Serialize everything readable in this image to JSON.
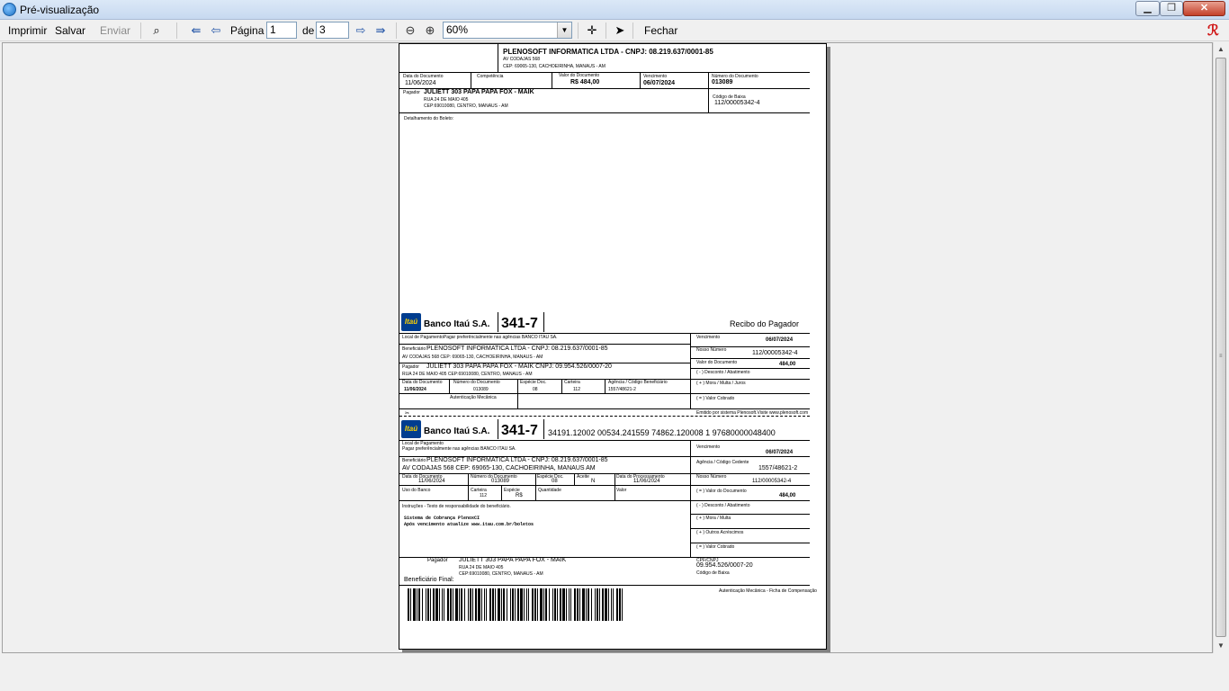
{
  "window": {
    "title": "Pré-visualização"
  },
  "toolbar": {
    "print_label": "Imprimir",
    "save_label": "Salvar",
    "send_label": "Enviar",
    "page_label": "Página",
    "page_value": "1",
    "of_label": "de",
    "total_pages": "3",
    "zoom_value": "60%",
    "close_label": "Fechar"
  },
  "report": {
    "header": {
      "company": "PLENOSOFT INFORMATICA LTDA - CNPJ: 08.219.637/0001-85",
      "address1": "AV CODAJAS 568",
      "address2": "CEP: 69065-130, CACHOEIRINHA, MANAUS - AM"
    },
    "doc_row": {
      "data_doc_label": "Data do Documento",
      "data_doc": "11/06/2024",
      "competencia_label": "Competência",
      "valor_doc_label": "Valor do Documento",
      "valor_doc": "R$ 484,00",
      "vencimento_label": "Vencimento",
      "vencimento": "06/07/2024",
      "numero_doc_label": "Número do Documento",
      "numero_doc": "013089"
    },
    "payer": {
      "label": "Pagador",
      "name": "JULIETT 303 PAPA PAPA FOX - MAIK",
      "addr1": "RUA 24 DE MAIO 405",
      "addr2": "CEP:69010080, CENTRO, MANAUS - AM",
      "codigo_baixa_label": "Código de Baixa",
      "codigo_baixa": "112/00005342-4"
    },
    "detalhamento_label": "Detalhamento do Boleto:"
  },
  "recibo": {
    "bank_logo": "Itaú",
    "bank_name": "Banco Itaú S.A.",
    "bank_code": "341-7",
    "title": "Recibo do Pagador",
    "local_pagamento": "Local de PagamentoPagar preferêncialmente nas agências BANCO ITAU SA.",
    "vencimento_label": "Vencimento",
    "vencimento": "06/07/2024",
    "beneficiario_label": "Beneficiário",
    "beneficiario": "PLENOSOFT INFORMATICA LTDA - CNPJ: 08.219.637/0001-85",
    "beneficiario_addr": "AV CODAJAS 568   CEP: 69065-130, CACHOEIRINHA, MANAUS - AM",
    "nosso_numero_label": "Nosso Número",
    "nosso_numero": "112/00005342-4",
    "pagador_label": "Pagador",
    "pagador": "JULIETT 303 PAPA PAPA FOX - MAIK  CNPJ: 09.954.526/0007-20",
    "pagador_addr": "RUA 24 DE MAIO 405  CEP:69010080, CENTRO, MANAUS - AM",
    "valor_doc_label": "Valor do Documento",
    "valor_doc": "484,00",
    "desconto_label": "( - ) Desconto / Abatimento",
    "data_doc_label": "Data do Documento",
    "data_doc": "11/06/2024",
    "numero_doc_label": "Número do Documento",
    "numero_doc": "013089",
    "especie_doc_label": "Espécie Doc.",
    "especie_doc": "08",
    "carteira_label": "Carteira",
    "carteira": "112",
    "agencia_label": "Agência / Código Beneficiário",
    "agencia": "1557/48621-2",
    "mora_label": "( + ) Mora / Multa / Juros",
    "autenticacao": "Autenticação Mecânica",
    "valor_cobrado_label": "( = ) Valor Cobrado",
    "emitido": "Emitido por sistema Plenosoft.Visite www.plenosoft.com",
    "cut_mark": "✂"
  },
  "ficha": {
    "bank_logo": "Itaú",
    "bank_name": "Banco Itaú S.A.",
    "bank_code": "341-7",
    "linha_digitavel": "34191.12002 00534.241559 74862.120008 1 97680000048400",
    "local_label": "Local de Pagamento",
    "local": "Pagar preferêncialmente nas agências BANCO ITAU SA.",
    "vencimento_label": "Vencimento",
    "vencimento": "06/07/2024",
    "beneficiario_label": "Beneficiário",
    "beneficiario": "PLENOSOFT INFORMATICA LTDA - CNPJ: 08.219.637/0001-85",
    "beneficiario_addr": "AV CODAJAS 568  CEP: 69065-130, CACHOEIRINHA, MANAUS AM",
    "agencia_label": "Agência / Código Cedente",
    "agencia": "1557/48621-2",
    "data_doc_label": "Data do Documento",
    "data_doc": "11/06/2024",
    "numero_doc_label": "Número do Documento",
    "numero_doc": "013089",
    "especie_doc_label": "Espécie Doc.",
    "especie_doc": "08",
    "aceite_label": "Aceite",
    "aceite": "N",
    "data_proc_label": "Data do Processamento",
    "data_proc": "11/06/2024",
    "nosso_numero_label": "Nosso Número",
    "nosso_numero": "112/00005342-4",
    "uso_banco_label": "Uso do Banco",
    "carteira_label": "Carteira",
    "carteira": "112",
    "especie_label": "Espécie",
    "especie": "R$",
    "quantidade_label": "Quantidade",
    "valor_label": "Valor",
    "valor_doc_label": "( = ) Valor do Documento",
    "valor_doc": "484,00",
    "instrucoes_label": "Instruções - Texto de responsabilidade do beneficiário.",
    "instrucao1": "Sistema de Cobrança PlenoxCI",
    "instrucao2": "Após vencimento atualize  www.itau.com.br/boletos",
    "desconto_label": "( - ) Desconto / Abatimento",
    "mora_label": "( + ) Mora / Multa",
    "outros_label": "( + ) Outros Acréscimos",
    "valor_cobrado_label": "( = ) Valor Cobrado",
    "pagador_label": "Pagador",
    "pagador": "JULIETT 303 PAPA PAPA FOX - MAIK",
    "pagador_addr1": "RUA 24 DE MAIO 405",
    "pagador_addr2": "CEP:69010080, CENTRO, MANAUS - AM",
    "cpf_label": "CPF/CNPJ",
    "cpf": "09.954.526/0007-20",
    "codigo_baixa_label": "Código de Baixa",
    "beneficiario_final_label": "Beneficiário Final:",
    "autenticacao": "Autenticação Mecânica - Ficha de Compensação"
  }
}
